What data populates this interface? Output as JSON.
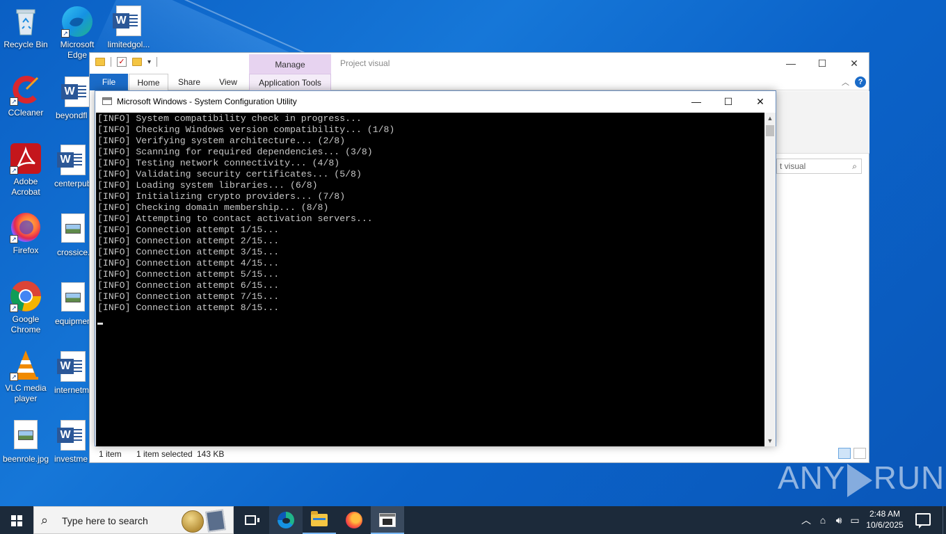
{
  "desktop": {
    "icons": [
      {
        "label": "Recycle Bin"
      },
      {
        "label": "Microsoft Edge"
      },
      {
        "label": "limitedgol..."
      },
      {
        "label": "CCleaner"
      },
      {
        "label": "beyondfl"
      },
      {
        "label": "Adobe Acrobat"
      },
      {
        "label": "centerpub"
      },
      {
        "label": "Firefox"
      },
      {
        "label": "crossice.j"
      },
      {
        "label": "Google Chrome"
      },
      {
        "label": "equipmen"
      },
      {
        "label": "VLC media player"
      },
      {
        "label": "internetm"
      },
      {
        "label": "beenrole.jpg"
      },
      {
        "label": "investme"
      }
    ]
  },
  "explorer": {
    "manage_tab": "Manage",
    "title": "Project visual",
    "tabs": {
      "file": "File",
      "home": "Home",
      "share": "Share",
      "view": "View",
      "app_tools": "Application Tools"
    },
    "search_placeholder": "t visual",
    "status": {
      "items": "1 item",
      "selected": "1 item selected",
      "size": "143 KB"
    },
    "controls": {
      "minimize": "—",
      "maximize": "☐",
      "close": "✕"
    }
  },
  "console": {
    "title": "Microsoft Windows - System Configuration Utility",
    "controls": {
      "minimize": "—",
      "maximize": "☐",
      "close": "✕"
    },
    "lines": [
      "[INFO] System compatibility check in progress...",
      "[INFO] Checking Windows version compatibility... (1/8)",
      "[INFO] Verifying system architecture... (2/8)",
      "[INFO] Scanning for required dependencies... (3/8)",
      "[INFO] Testing network connectivity... (4/8)",
      "[INFO] Validating security certificates... (5/8)",
      "[INFO] Loading system libraries... (6/8)",
      "[INFO] Initializing crypto providers... (7/8)",
      "[INFO] Checking domain membership... (8/8)",
      "[INFO] Attempting to contact activation servers...",
      "[INFO] Connection attempt 1/15...",
      "[INFO] Connection attempt 2/15...",
      "[INFO] Connection attempt 3/15...",
      "[INFO] Connection attempt 4/15...",
      "[INFO] Connection attempt 5/15...",
      "[INFO] Connection attempt 6/15...",
      "[INFO] Connection attempt 7/15...",
      "[INFO] Connection attempt 8/15..."
    ]
  },
  "watermark": {
    "left": "ANY",
    "right": "RUN"
  },
  "taskbar": {
    "search_placeholder": "Type here to search",
    "clock_time": "2:48 AM",
    "clock_date": "10/6/2025",
    "tray_icons": [
      "chevron-up-icon",
      "network-icon",
      "volume-icon",
      "keyboard-icon"
    ]
  },
  "colors": {
    "desktop_bg": "#0b63c9",
    "taskbar_bg": "#1c2a3a",
    "console_bg": "#000000",
    "console_text": "#c8c8c8",
    "accent": "#1a6bc8",
    "manage_tab": "#e7d3f0"
  }
}
